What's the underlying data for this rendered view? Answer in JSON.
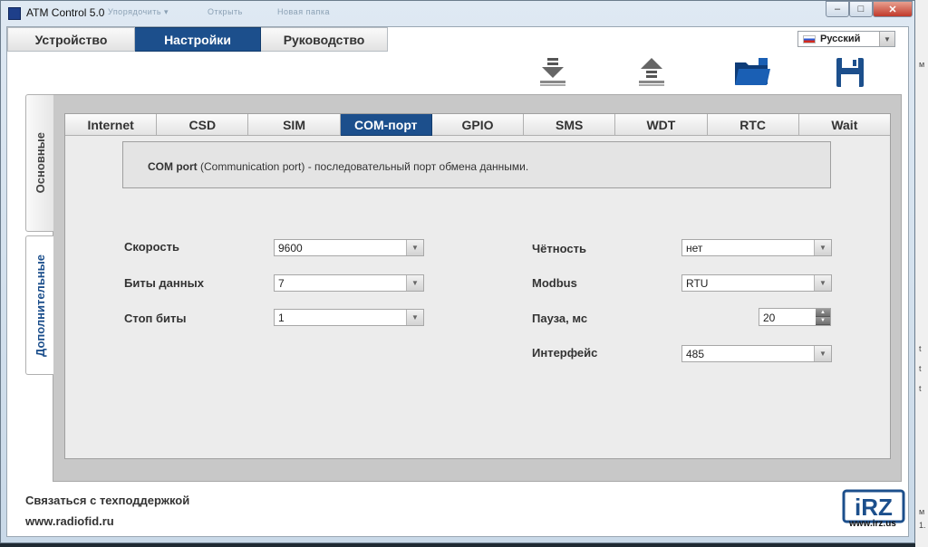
{
  "window": {
    "title": "ATM Control 5.0",
    "ghost_menu": [
      "Упорядочить ▾",
      "Открыть",
      "Новая папка"
    ],
    "controls": {
      "minimize": "–",
      "maximize": "□",
      "close": "✕"
    }
  },
  "main_tabs": [
    {
      "label": "Устройство",
      "active": false
    },
    {
      "label": "Настройки",
      "active": true
    },
    {
      "label": "Руководство",
      "active": false
    }
  ],
  "language": {
    "selected": "Русский"
  },
  "toolbar": {
    "icons": [
      "download-icon",
      "upload-icon",
      "open-folder-icon",
      "save-disk-icon"
    ]
  },
  "side_tabs": [
    {
      "label": "Основные",
      "active": false
    },
    {
      "label": "Дополнительные",
      "active": true
    }
  ],
  "sub_tabs": [
    {
      "label": "Internet",
      "active": false
    },
    {
      "label": "CSD",
      "active": false
    },
    {
      "label": "SIM",
      "active": false
    },
    {
      "label": "COM-порт",
      "active": true
    },
    {
      "label": "GPIO",
      "active": false
    },
    {
      "label": "SMS",
      "active": false
    },
    {
      "label": "WDT",
      "active": false
    },
    {
      "label": "RTC",
      "active": false
    },
    {
      "label": "Wait",
      "active": false
    }
  ],
  "description": {
    "term": "COM port",
    "text": " (Communication port) - последовательный порт обмена данными."
  },
  "fields": {
    "speed": {
      "label": "Скорость",
      "value": "9600"
    },
    "data_bits": {
      "label": "Биты данных",
      "value": "7"
    },
    "stop_bits": {
      "label": "Стоп биты",
      "value": "1"
    },
    "parity": {
      "label": "Чётность",
      "value": "нет"
    },
    "modbus": {
      "label": "Modbus",
      "value": "RTU"
    },
    "pause": {
      "label": "Пауза, мс",
      "value": "20"
    },
    "interface": {
      "label": "Интерфейс",
      "value": "485"
    }
  },
  "footer": {
    "support": "Связаться с техподдержкой",
    "site": "www.radiofid.ru",
    "logo_text": "iRZ",
    "logo_url": "www.irz.us"
  },
  "background_fragments": [
    "м",
    "t",
    "t",
    "t",
    "м",
    "1."
  ],
  "colors": {
    "accent": "#1c4f8c",
    "panel": "#ececec",
    "frame": "#c8c8c8"
  }
}
